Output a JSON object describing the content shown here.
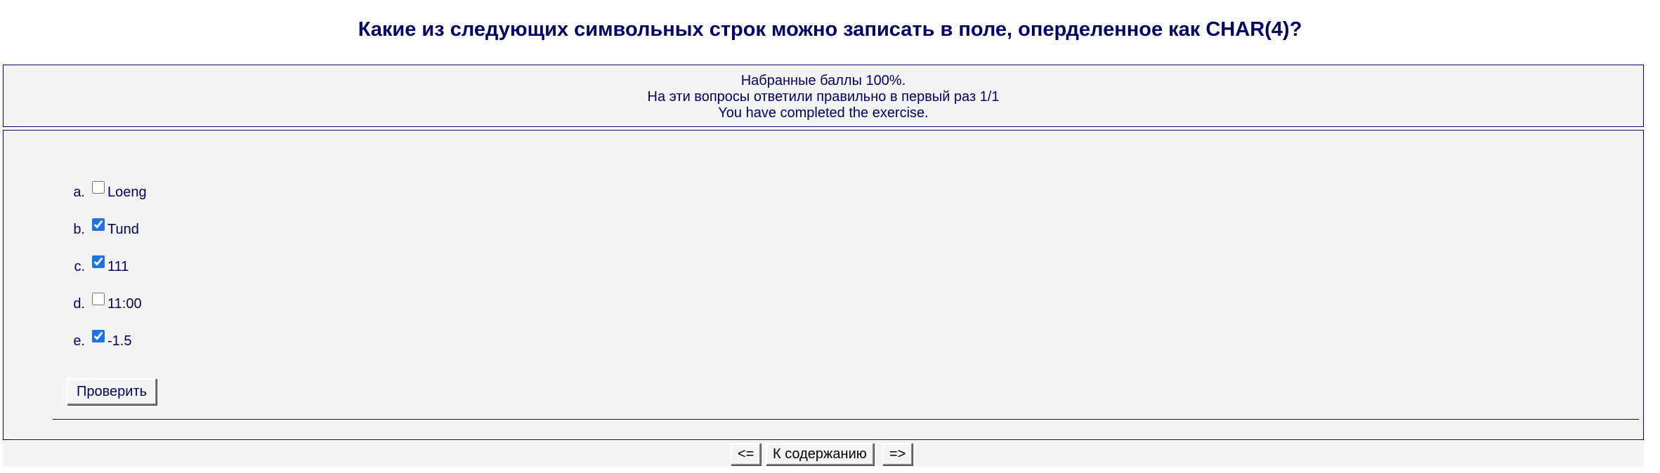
{
  "question": {
    "title": "Какие из следующих символьных строк можно записать в поле, оперделенное как CHAR(4)?"
  },
  "feedback": {
    "score": "Набранные баллы 100%.",
    "first_try": "На эти вопросы ответили правильно в первый раз 1/1",
    "completed": "You have completed the exercise."
  },
  "options": [
    {
      "letter": "a.",
      "label": "Loeng",
      "checked": false
    },
    {
      "letter": "b.",
      "label": "Tund",
      "checked": true
    },
    {
      "letter": "c.",
      "label": "111",
      "checked": true
    },
    {
      "letter": "d.",
      "label": "11:00",
      "checked": false
    },
    {
      "letter": "e.",
      "label": "-1.5",
      "checked": true
    }
  ],
  "check_button_label": "Проверить",
  "nav": {
    "prev_label": "<=",
    "contents_label": "К содержанию",
    "next_label": "=>"
  }
}
